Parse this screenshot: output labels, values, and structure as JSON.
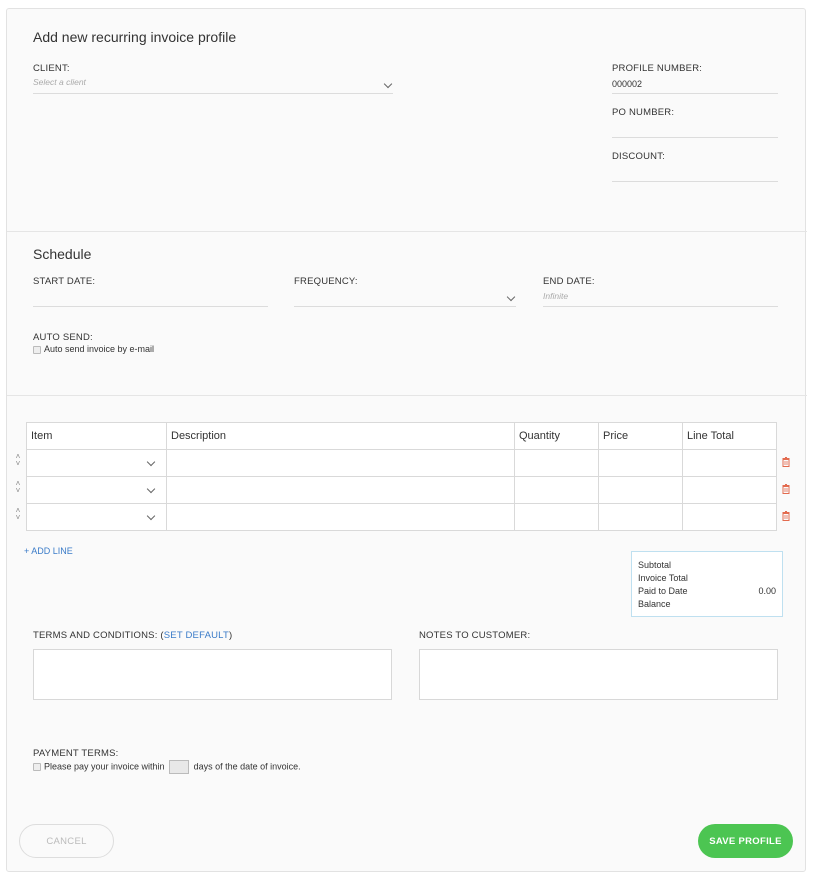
{
  "header": {
    "title": "Add new recurring invoice profile"
  },
  "client": {
    "label": "CLIENT:",
    "placeholder": "Select a client"
  },
  "profile_number": {
    "label": "PROFILE NUMBER:",
    "value": "000002"
  },
  "po_number": {
    "label": "PO NUMBER:",
    "value": ""
  },
  "discount": {
    "label": "DISCOUNT:",
    "value": ""
  },
  "schedule": {
    "title": "Schedule",
    "start_date_label": "START DATE:",
    "frequency_label": "FREQUENCY:",
    "end_date_label": "END DATE:",
    "end_date_placeholder": "Infinite",
    "auto_send_label": "AUTO SEND:",
    "auto_send_checkbox_label": "Auto send invoice by e-mail"
  },
  "items_table": {
    "columns": [
      "Item",
      "Description",
      "Quantity",
      "Price",
      "Line Total"
    ],
    "rows": [
      {
        "item": "",
        "description": "",
        "quantity": "",
        "price": "",
        "line_total": ""
      },
      {
        "item": "",
        "description": "",
        "quantity": "",
        "price": "",
        "line_total": ""
      },
      {
        "item": "",
        "description": "",
        "quantity": "",
        "price": "",
        "line_total": ""
      }
    ],
    "add_line_label": "+ ADD LINE"
  },
  "totals": {
    "subtotal_label": "Subtotal",
    "invoice_total_label": "Invoice Total",
    "paid_to_date_label": "Paid to Date",
    "paid_to_date_value": "0.00",
    "balance_label": "Balance"
  },
  "terms": {
    "label": "TERMS AND CONDITIONS: (",
    "set_default_label": "SET DEFAULT",
    "label_close": ")"
  },
  "notes": {
    "label": "NOTES TO CUSTOMER:"
  },
  "payment_terms": {
    "label": "PAYMENT TERMS:",
    "text_before": "Please pay your invoice within",
    "text_after": "days of the date of invoice."
  },
  "buttons": {
    "cancel": "CANCEL",
    "save": "SAVE PROFILE"
  },
  "colors": {
    "accent_green": "#4cc552",
    "link_blue": "#3a7bc8",
    "trash_red": "#e36b4f"
  }
}
